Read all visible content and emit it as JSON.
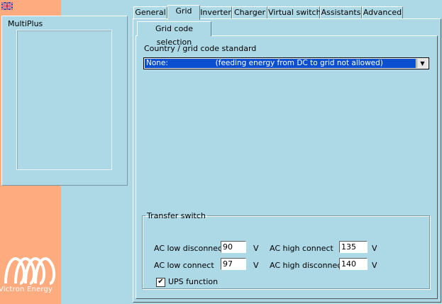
{
  "device": {
    "title": "MultiPlus"
  },
  "brand": {
    "logo_text": "Victron Energy"
  },
  "tabs": [
    {
      "label": "General"
    },
    {
      "label": "Grid"
    },
    {
      "label": "Inverter"
    },
    {
      "label": "Charger"
    },
    {
      "label": "Virtual switch"
    },
    {
      "label": "Assistants"
    },
    {
      "label": "Advanced"
    }
  ],
  "subtab": {
    "label": "Grid code selection"
  },
  "country": {
    "label": "Country / grid code standard",
    "selected": "None:                    (feeding energy from DC to grid not allowed)"
  },
  "transfer": {
    "title": "Transfer switch",
    "ac_low_disconnect": {
      "label": "AC low disconnect",
      "value": "90",
      "unit": "V"
    },
    "ac_low_connect": {
      "label": "AC low connect",
      "value": "97",
      "unit": "V"
    },
    "ac_high_connect": {
      "label": "AC high connect",
      "value": "135",
      "unit": "V"
    },
    "ac_high_disconnect": {
      "label": "AC high disconnect",
      "value": "140",
      "unit": "V"
    },
    "ups": {
      "label": "UPS function",
      "checked": "✔"
    }
  },
  "colors": {
    "background": "#add8e6",
    "sidebar": "#ffab80",
    "selection": "#0a4fd0"
  }
}
